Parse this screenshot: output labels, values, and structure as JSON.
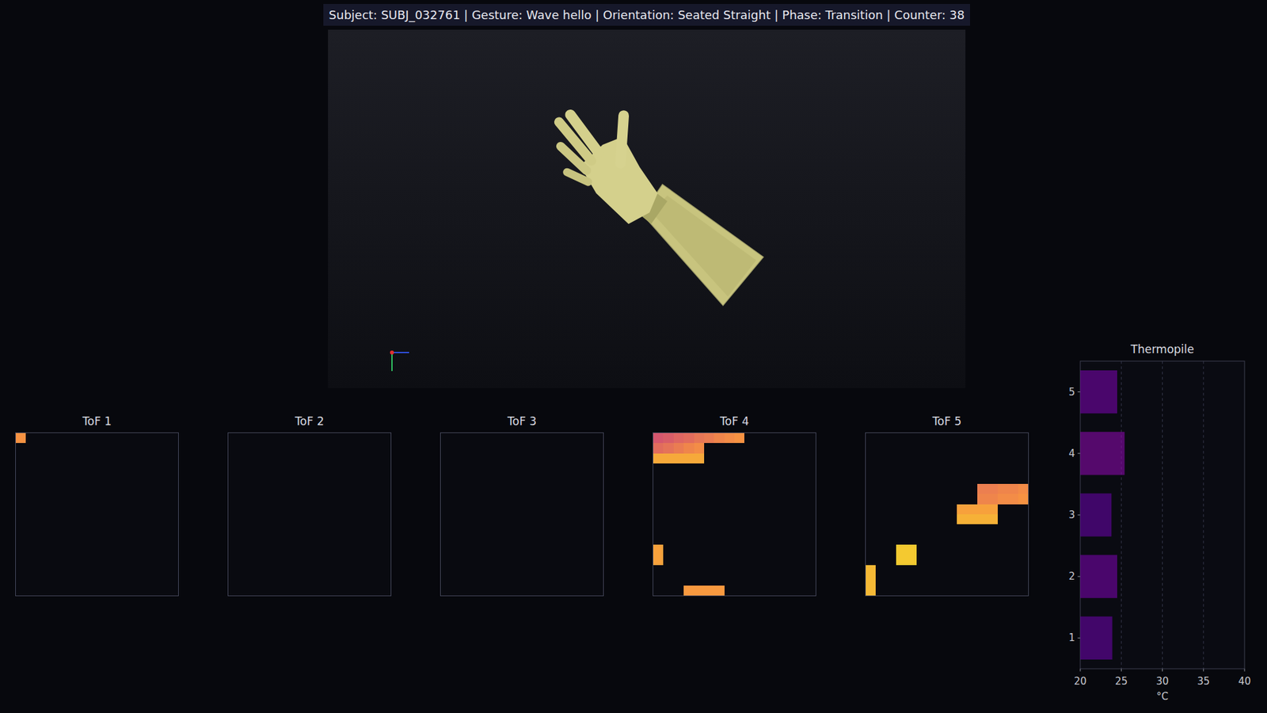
{
  "header": "Subject: SUBJ_032761 | Gesture: Wave hello | Orientation: Seated Straight | Phase: Transition | Counter: 38",
  "tof_sensors": [
    {
      "title": "ToF 1",
      "cells": [
        [
          0,
          0,
          0.74
        ]
      ]
    },
    {
      "title": "ToF 2",
      "cells": []
    },
    {
      "title": "ToF 3",
      "cells": []
    },
    {
      "title": "ToF 4",
      "cells": [
        [
          0,
          0,
          0.55
        ],
        [
          0,
          1,
          0.57
        ],
        [
          0,
          2,
          0.6
        ],
        [
          0,
          3,
          0.62
        ],
        [
          0,
          4,
          0.65
        ],
        [
          0,
          5,
          0.67
        ],
        [
          0,
          6,
          0.7
        ],
        [
          0,
          7,
          0.72
        ],
        [
          0,
          8,
          0.74
        ],
        [
          1,
          0,
          0.62
        ],
        [
          1,
          1,
          0.64
        ],
        [
          1,
          2,
          0.67
        ],
        [
          1,
          3,
          0.7
        ],
        [
          1,
          4,
          0.72
        ],
        [
          2,
          0,
          0.8
        ],
        [
          2,
          1,
          0.8
        ],
        [
          2,
          2,
          0.8
        ],
        [
          2,
          3,
          0.8
        ],
        [
          2,
          4,
          0.8
        ],
        [
          11,
          0,
          0.78
        ],
        [
          12,
          0,
          0.78
        ],
        [
          15,
          3,
          0.76
        ],
        [
          15,
          4,
          0.76
        ],
        [
          15,
          5,
          0.76
        ],
        [
          15,
          6,
          0.76
        ]
      ]
    },
    {
      "title": "ToF 5",
      "cells": [
        [
          5,
          11,
          0.68
        ],
        [
          5,
          12,
          0.68
        ],
        [
          5,
          13,
          0.7
        ],
        [
          5,
          14,
          0.7
        ],
        [
          5,
          15,
          0.72
        ],
        [
          6,
          11,
          0.7
        ],
        [
          6,
          12,
          0.7
        ],
        [
          6,
          13,
          0.72
        ],
        [
          6,
          14,
          0.72
        ],
        [
          6,
          15,
          0.74
        ],
        [
          7,
          9,
          0.78
        ],
        [
          7,
          10,
          0.78
        ],
        [
          7,
          11,
          0.78
        ],
        [
          7,
          12,
          0.78
        ],
        [
          8,
          9,
          0.82
        ],
        [
          8,
          10,
          0.82
        ],
        [
          8,
          11,
          0.82
        ],
        [
          8,
          12,
          0.82
        ],
        [
          11,
          3,
          0.88
        ],
        [
          11,
          4,
          0.88
        ],
        [
          12,
          3,
          0.88
        ],
        [
          12,
          4,
          0.88
        ],
        [
          13,
          0,
          0.84
        ],
        [
          14,
          0,
          0.84
        ],
        [
          15,
          0,
          0.84
        ]
      ]
    }
  ],
  "thermopile": {
    "title": "Thermopile",
    "x_label": "°C",
    "x_range": [
      20,
      40
    ],
    "x_ticks": [
      "20",
      "25",
      "30",
      "35",
      "40"
    ],
    "sensors": [
      {
        "label": "1",
        "value": 23.9
      },
      {
        "label": "2",
        "value": 24.5
      },
      {
        "label": "3",
        "value": 23.8
      },
      {
        "label": "4",
        "value": 25.4
      },
      {
        "label": "5",
        "value": 24.5
      }
    ]
  }
}
